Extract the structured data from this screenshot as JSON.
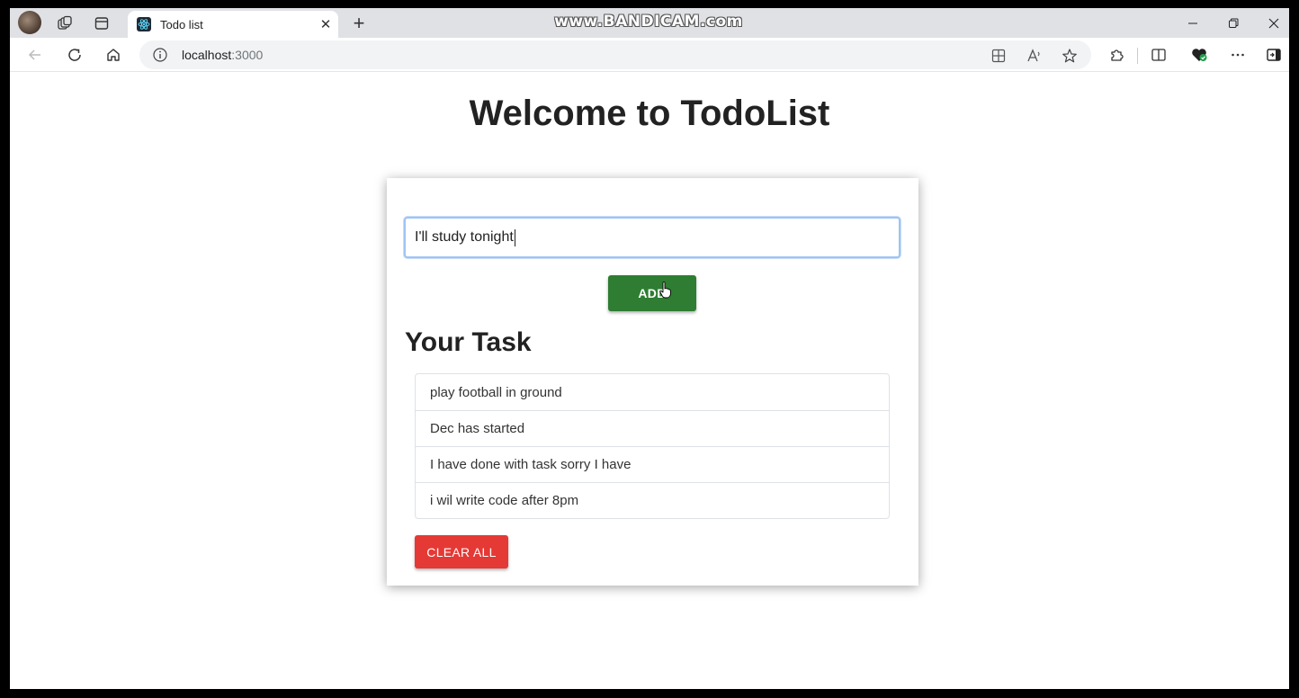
{
  "browser": {
    "tab_title": "Todo list",
    "url_host": "localhost",
    "url_port": ":3000",
    "watermark": "www.BANDICAM.com"
  },
  "icons": {
    "avatar": "profile-avatar",
    "workspaces": "workspaces-icon",
    "tab_actions": "tab-actions-icon",
    "favicon": "react-icon",
    "close_tab": "close-icon",
    "new_tab": "plus-icon",
    "minimize": "minimize-icon",
    "restore": "restore-icon",
    "close_window": "close-icon",
    "back": "back-arrow-icon",
    "reload": "reload-icon",
    "home": "home-icon",
    "site_info": "info-icon",
    "app_available": "app-install-icon",
    "read_aloud": "read-aloud-icon",
    "favorite": "star-icon",
    "extensions": "puzzle-icon",
    "split_screen": "split-screen-icon",
    "browser_essentials": "heart-shield-icon",
    "more": "more-icon",
    "sidebar": "sidebar-icon",
    "pointer": "hand-pointer-icon"
  },
  "page": {
    "heading": "Welcome to TodoList",
    "input_value": "I'll study tonight",
    "add_label": "ADD",
    "section_title": "Your Task",
    "tasks": [
      "play football in ground",
      "Dec has started",
      "I have done with task sorry I have",
      "i wil write code after 8pm"
    ],
    "clear_label": "CLEAR ALL"
  },
  "colors": {
    "add_button": "#2e7d32",
    "clear_button": "#e53935",
    "input_focus_border": "#9ec4f3",
    "tabstrip_bg": "#dfe1e5"
  }
}
